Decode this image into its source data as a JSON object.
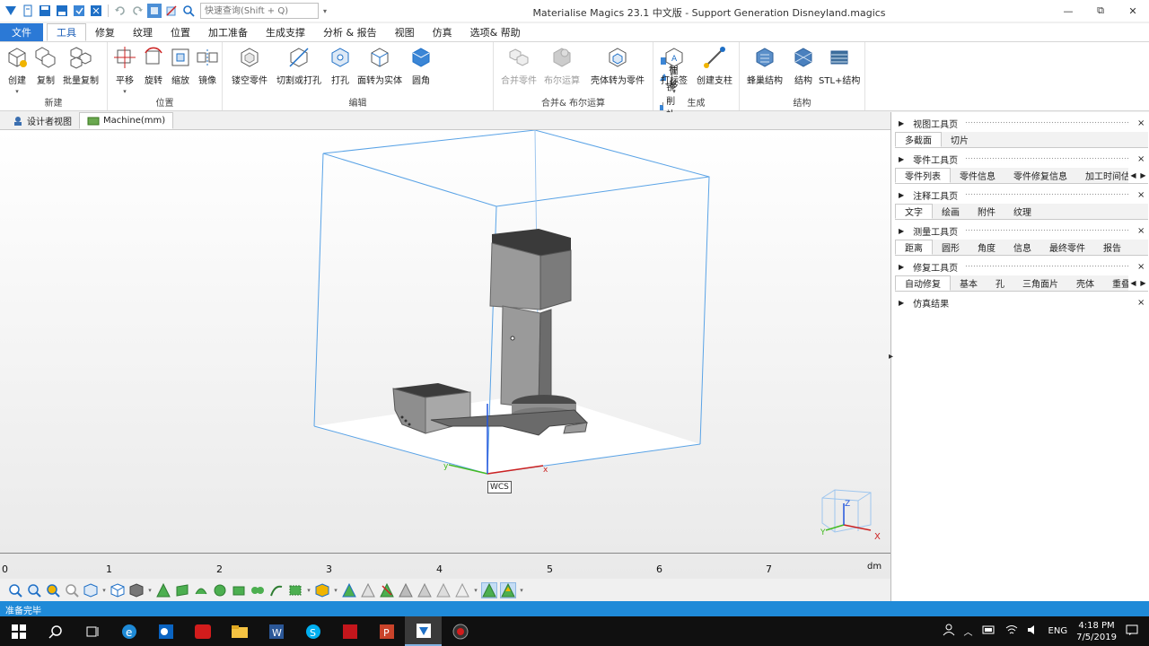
{
  "window": {
    "title": "Materialise Magics 23.1 中文版 - Support Generation Disneyland.magics",
    "search_placeholder": "快速查询(Shift + Q)",
    "controls": [
      "—",
      "⧉",
      "✕"
    ]
  },
  "quick_access_icons": [
    "app-logo-icon",
    "new-file-icon",
    "save-icon",
    "save-as-icon",
    "save-all-icon",
    "export-icon",
    "undo-icon",
    "redo-icon",
    "select-icon",
    "deselect-icon",
    "quick-search-icon"
  ],
  "ribbon_tabs": [
    {
      "label": "文件",
      "kind": "file"
    },
    {
      "label": "工具",
      "kind": "active"
    },
    {
      "label": "修复"
    },
    {
      "label": "纹理"
    },
    {
      "label": "位置"
    },
    {
      "label": "加工准备"
    },
    {
      "label": "生成支撑"
    },
    {
      "label": "分析 & 报告"
    },
    {
      "label": "视图"
    },
    {
      "label": "仿真"
    },
    {
      "label": "选项& 帮助"
    }
  ],
  "ribbon": {
    "groups": {
      "new": "新建",
      "position": "位置",
      "edit": "编辑",
      "merge_boolean": "合并& 布尔运算",
      "generate": "生成",
      "structure": "结构"
    },
    "buttons": {
      "create": "创建",
      "copy": "复制",
      "batch_copy": "批量复制",
      "translate": "平移",
      "rotate": "旋转",
      "scale": "缩放",
      "mirror": "镜像",
      "hollow": "镂空零件",
      "cut_punch": "切割或打孔",
      "punch": "打孔",
      "face_to_solid": "面转为实体",
      "fillet": "圆角",
      "extrude": "拉伸",
      "offset": "偏移",
      "mill_compensate": "铣削补偿",
      "merge": "合并零件",
      "boolean": "布尔运算",
      "shell_to_part": "壳体转为零件",
      "label": "打标签",
      "create_support": "创建支柱",
      "honeycomb": "蜂巢结构",
      "structure": "结构",
      "stl_structure": "STL+结构"
    }
  },
  "view_tabs": [
    {
      "label": "设计者视图",
      "active": false
    },
    {
      "label": "Machine(mm)",
      "active": true
    }
  ],
  "viewport": {
    "wcs_label": "WCS",
    "axes": {
      "x": "x",
      "y": "y"
    },
    "navcube_axes": {
      "x": "X",
      "y": "Y",
      "z": "Z"
    },
    "colors": {
      "bbox": "#5aa3e6",
      "part": "#8e8e8e",
      "x_axis": "#cc2222",
      "y_axis": "#44bb22",
      "z_axis": "#2255dd"
    }
  },
  "ruler": {
    "ticks": [
      "0",
      "1",
      "2",
      "3",
      "4",
      "5",
      "6",
      "7"
    ],
    "unit": "dm"
  },
  "bottom_toolbar_icons": [
    "zoom-icon",
    "zoom-window-icon",
    "pan-icon",
    "zoom-fit-icon",
    "view-cube-icon",
    "part-view-icon",
    "solid-view-icon",
    "triangle-mark-icon",
    "surface-mark-icon",
    "shell-mark-icon",
    "sphere-mark-icon",
    "plane-mark-icon",
    "curve-mark-icon",
    "line-mark-icon",
    "select-box-icon",
    "part-select-icon",
    "mark-all-icon",
    "unmark-icon",
    "invert-mark-icon",
    "delete-mark-icon",
    "expand-mark-icon",
    "shrink-mark-icon",
    "grow-mark-icon",
    "smooth-mark-icon",
    "highlight-mark-icon",
    "display-mark-icon"
  ],
  "status": {
    "text": "准备完毕"
  },
  "right_panel": {
    "pages": [
      {
        "title": "视图工具页",
        "tabs": [
          "多截面",
          "切片"
        ],
        "active": 0,
        "nav": false
      },
      {
        "title": "零件工具页",
        "tabs": [
          "零件列表",
          "零件信息",
          "零件修复信息",
          "加工时间估"
        ],
        "active": 0,
        "nav": true
      },
      {
        "title": "注释工具页",
        "tabs": [
          "文字",
          "绘画",
          "附件",
          "纹理"
        ],
        "active": 0,
        "nav": false
      },
      {
        "title": "测量工具页",
        "tabs": [
          "距离",
          "圆形",
          "角度",
          "信息",
          "最终零件",
          "报告"
        ],
        "active": 0,
        "nav": false
      },
      {
        "title": "修复工具页",
        "tabs": [
          "自动修复",
          "基本",
          "孔",
          "三角面片",
          "壳体",
          "重叠"
        ],
        "active": 0,
        "nav": true
      },
      {
        "title": "仿真结果",
        "tabs": [],
        "active": -1,
        "nav": false
      }
    ]
  },
  "taskbar": {
    "apps": [
      "windows-start-icon",
      "search-icon",
      "task-view-icon",
      "edge-icon",
      "outlook-icon",
      "youdao-icon",
      "file-explorer-icon",
      "word-icon",
      "skype-icon",
      "acrobat-icon",
      "powerpoint-icon",
      "magics-icon",
      "recorder-icon"
    ],
    "tray": {
      "lang": "ENG",
      "time": "4:18 PM",
      "date": "7/5/2019"
    }
  }
}
